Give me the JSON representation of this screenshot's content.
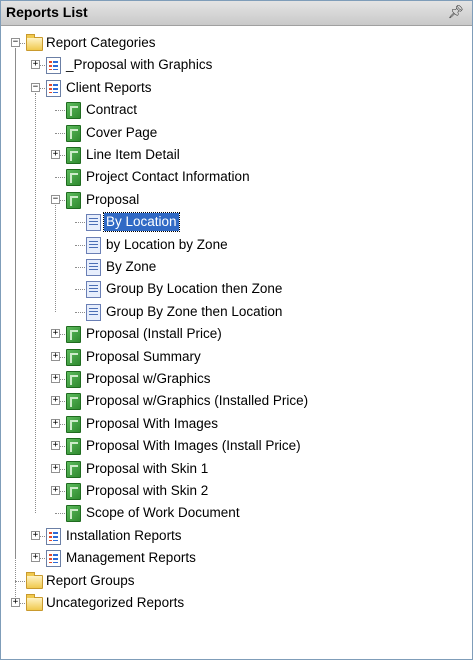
{
  "panel": {
    "title": "Reports List",
    "pin_icon": "pin-icon"
  },
  "tree": [
    {
      "depth": 0,
      "label": "Report Categories",
      "icon": "folder-icon",
      "expander": "minus"
    },
    {
      "depth": 1,
      "label": "_Proposal with Graphics",
      "icon": "report-category-icon",
      "expander": "plus"
    },
    {
      "depth": 1,
      "label": "Client Reports",
      "icon": "report-category-icon",
      "expander": "minus"
    },
    {
      "depth": 2,
      "label": "Contract",
      "icon": "report-icon",
      "expander": "none"
    },
    {
      "depth": 2,
      "label": "Cover Page",
      "icon": "report-icon",
      "expander": "none"
    },
    {
      "depth": 2,
      "label": "Line Item Detail",
      "icon": "report-icon",
      "expander": "plus"
    },
    {
      "depth": 2,
      "label": "Project Contact Information",
      "icon": "report-icon",
      "expander": "none"
    },
    {
      "depth": 2,
      "label": "Proposal",
      "icon": "report-icon",
      "expander": "minus"
    },
    {
      "depth": 3,
      "label": "By Location",
      "icon": "report-layout-icon",
      "expander": "none",
      "selected": true
    },
    {
      "depth": 3,
      "label": "by Location by Zone",
      "icon": "report-layout-icon",
      "expander": "none"
    },
    {
      "depth": 3,
      "label": "By Zone",
      "icon": "report-layout-icon",
      "expander": "none"
    },
    {
      "depth": 3,
      "label": "Group By Location then Zone",
      "icon": "report-layout-icon",
      "expander": "none"
    },
    {
      "depth": 3,
      "label": "Group By Zone then Location",
      "icon": "report-layout-icon",
      "expander": "none"
    },
    {
      "depth": 2,
      "label": "Proposal (Install Price)",
      "icon": "report-icon",
      "expander": "plus"
    },
    {
      "depth": 2,
      "label": "Proposal Summary",
      "icon": "report-icon",
      "expander": "plus"
    },
    {
      "depth": 2,
      "label": "Proposal w/Graphics",
      "icon": "report-icon",
      "expander": "plus"
    },
    {
      "depth": 2,
      "label": "Proposal w/Graphics (Installed Price)",
      "icon": "report-icon",
      "expander": "plus"
    },
    {
      "depth": 2,
      "label": "Proposal With Images",
      "icon": "report-icon",
      "expander": "plus"
    },
    {
      "depth": 2,
      "label": "Proposal With Images (Install Price)",
      "icon": "report-icon",
      "expander": "plus"
    },
    {
      "depth": 2,
      "label": "Proposal with Skin 1",
      "icon": "report-icon",
      "expander": "plus"
    },
    {
      "depth": 2,
      "label": "Proposal with Skin 2",
      "icon": "report-icon",
      "expander": "plus"
    },
    {
      "depth": 2,
      "label": "Scope of Work Document",
      "icon": "report-icon",
      "expander": "none"
    },
    {
      "depth": 1,
      "label": "Installation Reports",
      "icon": "report-category-icon",
      "expander": "plus"
    },
    {
      "depth": 1,
      "label": "Management Reports",
      "icon": "report-category-icon",
      "expander": "plus"
    },
    {
      "depth": 0,
      "label": "Report Groups",
      "icon": "folder-icon",
      "expander": "none"
    },
    {
      "depth": 0,
      "label": "Uncategorized Reports",
      "icon": "folder-icon",
      "expander": "plus"
    }
  ],
  "colors": {
    "selection": "#316ac5",
    "border": "#7f9db9"
  }
}
